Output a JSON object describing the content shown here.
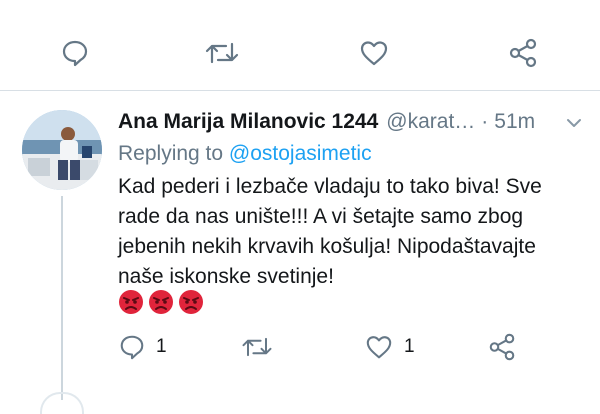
{
  "top_actions": {
    "reply_icon": "reply-icon",
    "retweet_icon": "retweet-icon",
    "like_icon": "heart-icon",
    "share_icon": "share-icon"
  },
  "tweet": {
    "author_name": "Ana Marija Milanovic 1244",
    "handle": "@karat…",
    "separator": "·",
    "time": "51m",
    "replying_prefix": "Replying to",
    "replying_to": "@ostojasimetic",
    "body_lines": [
      "Kad pederi i lezbače vladaju to tako biva! Sve",
      "rade da nas unište!!! A vi šetajte samo zbog",
      "jebenih nekih krvavih košulja! Nipodaštavajte",
      "naše iskonske svetinje!"
    ],
    "emojis": [
      "angry-face-emoji",
      "angry-face-emoji",
      "angry-face-emoji"
    ],
    "actions": {
      "reply_count": "1",
      "retweet_count": "",
      "like_count": "1"
    }
  },
  "colors": {
    "accent": "#1da1f2",
    "secondary_text": "#657786",
    "primary_text": "#14171a",
    "divider": "#d8dfe5",
    "emoji_red": "#e0243b"
  }
}
